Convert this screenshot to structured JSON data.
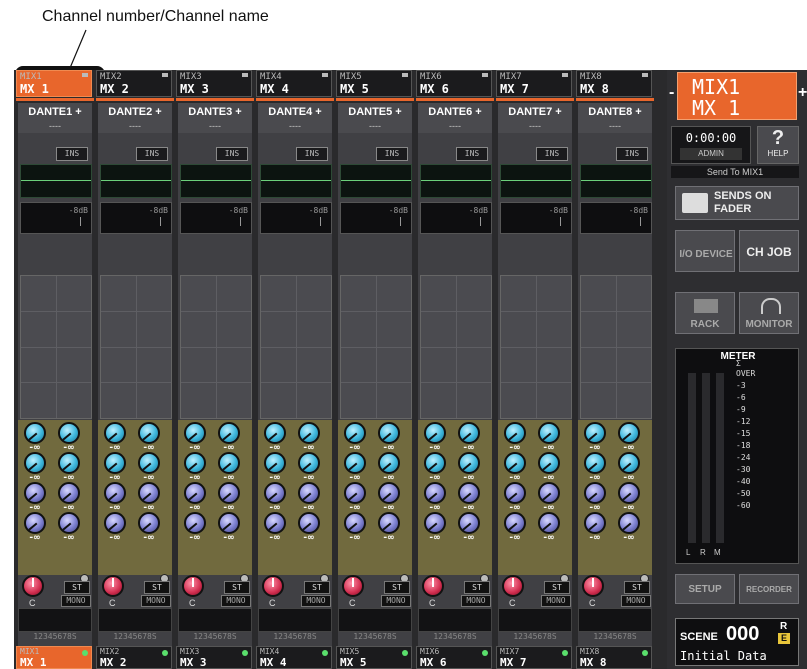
{
  "annotation": {
    "label": "Channel number/Channel name"
  },
  "strips": [
    {
      "num": "MIX1",
      "name": "MX 1",
      "input": "DANTE1 +",
      "input_sub": "----",
      "ins": "INS",
      "dyn_label": "-8dB",
      "knob_values": [
        "-∞",
        "-∞",
        "-∞",
        "-∞",
        "-∞",
        "-∞",
        "-∞",
        "-∞"
      ],
      "pan_label": "C",
      "st": "ST",
      "mono": "MONO",
      "assign": "12345678S",
      "selected": true
    },
    {
      "num": "MIX2",
      "name": "MX 2",
      "input": "DANTE2 +",
      "input_sub": "----",
      "ins": "INS",
      "dyn_label": "-8dB",
      "knob_values": [
        "-∞",
        "-∞",
        "-∞",
        "-∞",
        "-∞",
        "-∞",
        "-∞",
        "-∞"
      ],
      "pan_label": "C",
      "st": "ST",
      "mono": "MONO",
      "assign": "12345678S",
      "selected": false
    },
    {
      "num": "MIX3",
      "name": "MX 3",
      "input": "DANTE3 +",
      "input_sub": "----",
      "ins": "INS",
      "dyn_label": "-8dB",
      "knob_values": [
        "-∞",
        "-∞",
        "-∞",
        "-∞",
        "-∞",
        "-∞",
        "-∞",
        "-∞"
      ],
      "pan_label": "C",
      "st": "ST",
      "mono": "MONO",
      "assign": "12345678S",
      "selected": false
    },
    {
      "num": "MIX4",
      "name": "MX 4",
      "input": "DANTE4 +",
      "input_sub": "----",
      "ins": "INS",
      "dyn_label": "-8dB",
      "knob_values": [
        "-∞",
        "-∞",
        "-∞",
        "-∞",
        "-∞",
        "-∞",
        "-∞",
        "-∞"
      ],
      "pan_label": "C",
      "st": "ST",
      "mono": "MONO",
      "assign": "12345678S",
      "selected": false
    },
    {
      "num": "MIX5",
      "name": "MX 5",
      "input": "DANTE5 +",
      "input_sub": "----",
      "ins": "INS",
      "dyn_label": "-8dB",
      "knob_values": [
        "-∞",
        "-∞",
        "-∞",
        "-∞",
        "-∞",
        "-∞",
        "-∞",
        "-∞"
      ],
      "pan_label": "C",
      "st": "ST",
      "mono": "MONO",
      "assign": "12345678S",
      "selected": false
    },
    {
      "num": "MIX6",
      "name": "MX 6",
      "input": "DANTE6 +",
      "input_sub": "----",
      "ins": "INS",
      "dyn_label": "-8dB",
      "knob_values": [
        "-∞",
        "-∞",
        "-∞",
        "-∞",
        "-∞",
        "-∞",
        "-∞",
        "-∞"
      ],
      "pan_label": "C",
      "st": "ST",
      "mono": "MONO",
      "assign": "12345678S",
      "selected": false
    },
    {
      "num": "MIX7",
      "name": "MX 7",
      "input": "DANTE7 +",
      "input_sub": "----",
      "ins": "INS",
      "dyn_label": "-8dB",
      "knob_values": [
        "-∞",
        "-∞",
        "-∞",
        "-∞",
        "-∞",
        "-∞",
        "-∞",
        "-∞"
      ],
      "pan_label": "C",
      "st": "ST",
      "mono": "MONO",
      "assign": "12345678S",
      "selected": false
    },
    {
      "num": "MIX8",
      "name": "MX 8",
      "input": "DANTE8 +",
      "input_sub": "----",
      "ins": "INS",
      "dyn_label": "-8dB",
      "knob_values": [
        "-∞",
        "-∞",
        "-∞",
        "-∞",
        "-∞",
        "-∞",
        "-∞",
        "-∞"
      ],
      "pan_label": "C",
      "st": "ST",
      "mono": "MONO",
      "assign": "12345678S",
      "selected": false
    }
  ],
  "footer_tabs": [
    {
      "num": "MIX1",
      "name": "MX 1",
      "selected": true
    },
    {
      "num": "MIX2",
      "name": "MX 2",
      "selected": false
    },
    {
      "num": "MIX3",
      "name": "MX 3",
      "selected": false
    },
    {
      "num": "MIX4",
      "name": "MX 4",
      "selected": false
    },
    {
      "num": "MIX5",
      "name": "MX 5",
      "selected": false
    },
    {
      "num": "MIX6",
      "name": "MX 6",
      "selected": false
    },
    {
      "num": "MIX7",
      "name": "MX 7",
      "selected": false
    },
    {
      "num": "MIX8",
      "name": "MX 8",
      "selected": false
    }
  ],
  "right_panel": {
    "selected_num": "MIX1",
    "selected_name": "MX 1",
    "prev_symbol": "-",
    "next_symbol": "+",
    "time": "0:00:00",
    "user": "ADMIN",
    "help_symbol": "?",
    "help_label": "HELP",
    "send_to": "Send To MIX1",
    "sends_on_fader": "SENDS ON FADER",
    "io_device": "I/O DEVICE",
    "ch_job": "CH JOB",
    "rack": "RACK",
    "monitor": "MONITOR",
    "meter_title": "METER",
    "meter_scale": [
      "Σ",
      "OVER",
      "-3",
      "-6",
      "-9",
      "-12",
      "-15",
      "-18",
      "-24",
      "-30",
      "-40",
      "-50",
      "-60"
    ],
    "meter_channels": [
      "L",
      "R",
      "M"
    ],
    "setup": "SETUP",
    "recorder": "RECORDER",
    "scene_label": "SCENE",
    "scene_number": "000",
    "scene_r": "R",
    "scene_e": "E",
    "scene_title": "Initial Data"
  },
  "colors": {
    "accent_orange": "#e8662c",
    "knob_cyan": "#3cb6dc",
    "knob_purple": "#7b7ecf",
    "knob_pan_red": "#d12c4e",
    "panel_dark": "#2a2a2c"
  }
}
